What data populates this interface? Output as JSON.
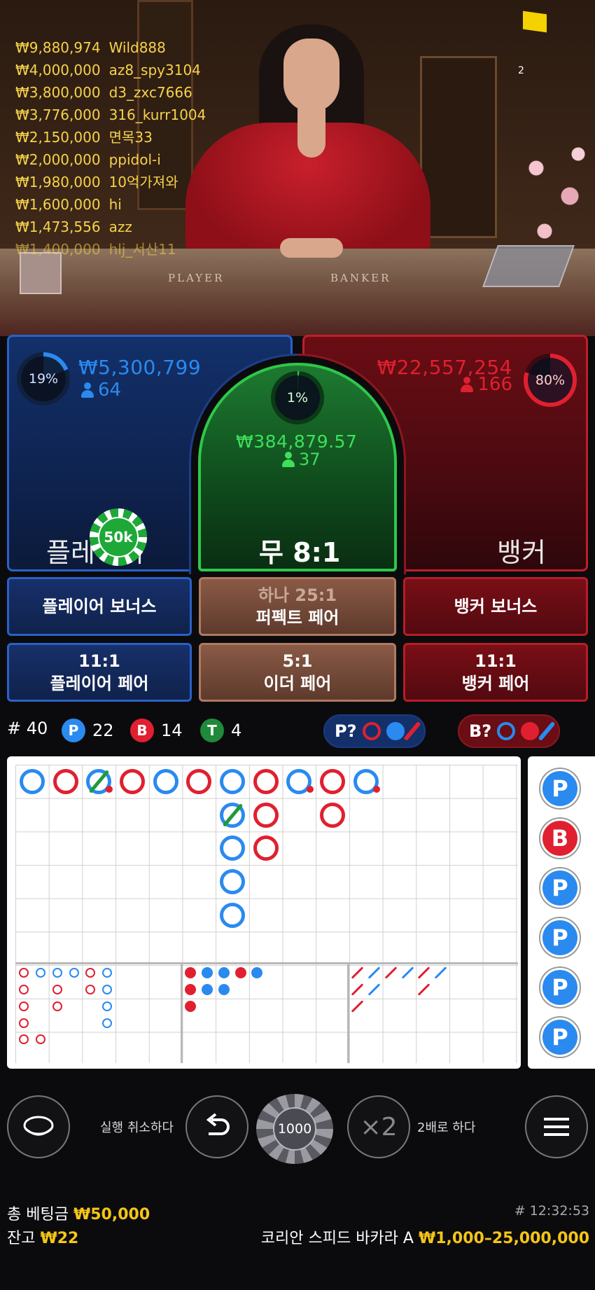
{
  "ticker": [
    {
      "amount": "₩9,880,974",
      "user": "Wild888"
    },
    {
      "amount": "₩4,000,000",
      "user": "az8_spy3104"
    },
    {
      "amount": "₩3,800,000",
      "user": "d3_zxc7666"
    },
    {
      "amount": "₩3,776,000",
      "user": "316_kurr1004"
    },
    {
      "amount": "₩2,150,000",
      "user": "면목33"
    },
    {
      "amount": "₩2,000,000",
      "user": "ppidol-i"
    },
    {
      "amount": "₩1,980,000",
      "user": "10억가져와"
    },
    {
      "amount": "₩1,600,000",
      "user": "hi"
    },
    {
      "amount": "₩1,473,556",
      "user": "azz"
    },
    {
      "amount": "₩1,400,000",
      "user": "hlj_서산11"
    }
  ],
  "video": {
    "viewer_count": "2",
    "table_player": "PLAYER",
    "table_banker": "BANKER"
  },
  "player": {
    "percent": "19%",
    "percent_value": 19,
    "amount": "₩5,300,799",
    "bettors": "64",
    "label": "플레이어",
    "color": "#2a8af0"
  },
  "banker": {
    "percent": "80%",
    "percent_value": 80,
    "amount": "₩22,557,254",
    "bettors": "166",
    "label": "뱅커",
    "color": "#e02030"
  },
  "tie": {
    "percent": "1%",
    "percent_value": 1,
    "amount": "₩384,879.57",
    "bettors": "37",
    "label": "무",
    "payout": "8:1",
    "color": "#2ec84a"
  },
  "placed_chip": {
    "label": "50k"
  },
  "side_bets": {
    "player_bonus": "플레이어 보너스",
    "perfect_pair_top": "하나 25:1",
    "perfect_pair": "퍼펙트 페어",
    "banker_bonus": "뱅커 보너스",
    "player_pair_odds": "11:1",
    "player_pair": "플레이어 페어",
    "either_pair_odds": "5:1",
    "either_pair": "이더 페어",
    "banker_pair_odds": "11:1",
    "banker_pair": "뱅커 페어"
  },
  "stats": {
    "rounds_label": "# 40",
    "p_badge": "P",
    "p_count": "22",
    "b_badge": "B",
    "b_count": "14",
    "t_badge": "T",
    "t_count": "4"
  },
  "predict": {
    "player": "P?",
    "banker": "B?"
  },
  "bead_road_side": [
    "P",
    "B",
    "P",
    "P",
    "P",
    "P"
  ],
  "controls": {
    "undo_label": "실행 취소하다",
    "chip_value": "1000",
    "double_symbol": "×2",
    "double_label": "2배로 하다"
  },
  "footer": {
    "total_bet_label": "총 베팅금",
    "total_bet": "₩50,000",
    "balance_label": "잔고",
    "balance": "₩22",
    "round_id": "# 12:32:53",
    "table_name": "코리안 스피드 바카라 A",
    "limits": "₩1,000–25,000,000"
  },
  "colors": {
    "player": "#2a8af0",
    "banker": "#e02030",
    "tie": "#2ec84a",
    "gold": "#f5c518"
  }
}
